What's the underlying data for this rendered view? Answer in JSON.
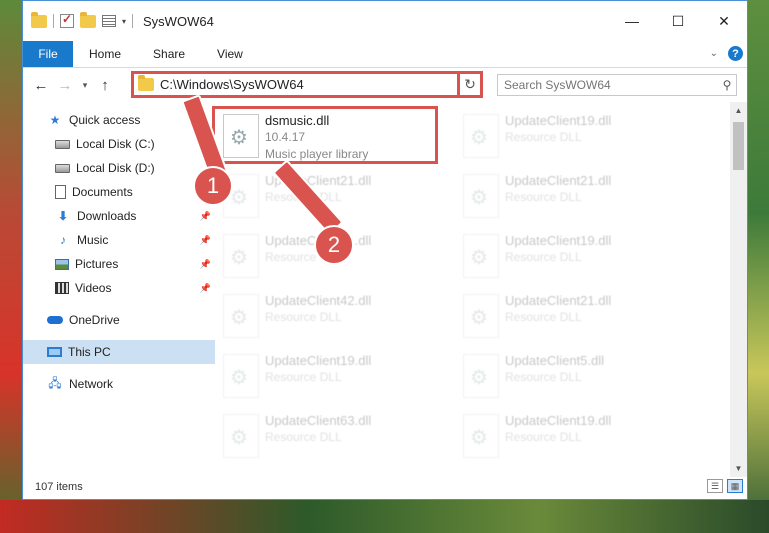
{
  "window": {
    "title": "SysWOW64"
  },
  "ribbon": {
    "tabs": [
      "File",
      "Home",
      "Share",
      "View"
    ],
    "help": "?"
  },
  "nav": {
    "back": "←",
    "forward": "→",
    "recent": "▾",
    "up": "↑"
  },
  "address": {
    "path": "C:\\Windows\\SysWOW64",
    "refresh_icon": "↻"
  },
  "search": {
    "placeholder": "Search SysWOW64"
  },
  "sidebar": {
    "items": [
      {
        "label": "Quick access"
      },
      {
        "label": "Local Disk (C:)"
      },
      {
        "label": "Local Disk (D:)"
      },
      {
        "label": "Documents"
      },
      {
        "label": "Downloads"
      },
      {
        "label": "Music"
      },
      {
        "label": "Pictures"
      },
      {
        "label": "Videos"
      },
      {
        "label": "OneDrive"
      },
      {
        "label": "This PC"
      },
      {
        "label": "Network"
      }
    ]
  },
  "files": [
    {
      "name": "dsmusic.dll",
      "version": "10.4.17",
      "desc": "Music player library"
    },
    {
      "name": "UpdateClient19.dll",
      "desc": "Resource DLL"
    },
    {
      "name": "UpdateClient21.dll",
      "desc": "Resource DLL"
    },
    {
      "name": "UpdateClient21.dll",
      "desc": "Resource DLL"
    },
    {
      "name": "UpdateClient21.dll",
      "desc": "Resource DLL"
    },
    {
      "name": "UpdateClient19.dll",
      "desc": "Resource DLL"
    },
    {
      "name": "UpdateClient42.dll",
      "desc": "Resource DLL"
    },
    {
      "name": "UpdateClient21.dll",
      "desc": "Resource DLL"
    },
    {
      "name": "UpdateClient19.dll",
      "desc": "Resource DLL"
    },
    {
      "name": "UpdateClient5.dll",
      "desc": "Resource DLL"
    },
    {
      "name": "UpdateClient63.dll",
      "desc": "Resource DLL"
    },
    {
      "name": "UpdateClient19.dll",
      "desc": "Resource DLL"
    }
  ],
  "status": {
    "count": "107 items"
  },
  "annotations": {
    "step1": "1",
    "step2": "2"
  },
  "colors": {
    "accent": "#1979ca",
    "highlight": "#d9534f"
  }
}
